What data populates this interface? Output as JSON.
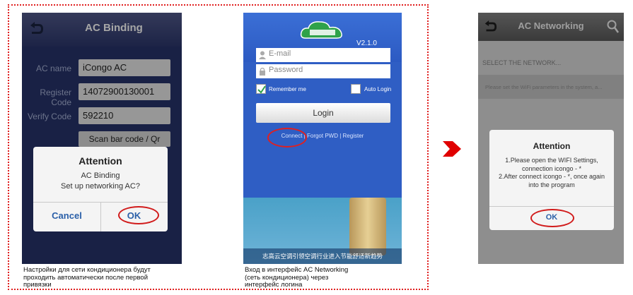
{
  "screen1": {
    "title": "AC Binding",
    "fields": [
      {
        "label": "AC name",
        "value": "iCongo AC"
      },
      {
        "label": "Register Code",
        "value": "14072900130001"
      },
      {
        "label": "Verify Code",
        "value": "592210"
      }
    ],
    "scan_button": "Scan bar code / Qr code",
    "dialog": {
      "title": "Attention",
      "line1": "AC Binding",
      "line2": "Set up networking AC?",
      "cancel": "Cancel",
      "ok": "OK"
    },
    "caption": [
      "Настройки для сети кондиционера будут",
      "проходить автоматически после первой",
      "привязки"
    ]
  },
  "screen2": {
    "version": "V2.1.0",
    "email_placeholder": "E-mail",
    "password_placeholder": "Password",
    "remember_me": "Remember me",
    "auto_login": "Auto Login",
    "login": "Login",
    "link_connect": "Connect",
    "link_forgot": "Forgot PWD",
    "link_register": "Register",
    "footer": "志高云空调引领空调行业进入节能舒适新趋势",
    "caption": [
      "Вход в интерфейс AC Networking",
      "(сеть кондиционера) через",
      "интерфейс логина"
    ]
  },
  "screen3": {
    "title": "AC Networking",
    "select_label": "SELECT THE NETWORK...",
    "hint": "Please set the WiFi parameters in the system, a...",
    "dialog": {
      "title": "Attention",
      "line1": "1.Please open the WIFI Settings,",
      "line2": "connection icongo - *",
      "line3": "2.After connect icongo - *, once again",
      "line4": "into the program",
      "ok": "OK"
    }
  },
  "colors": {
    "accent_red": "#d11b1b",
    "screen1_bg": "#27336a",
    "screen2_bg": "#2f5ec4"
  }
}
